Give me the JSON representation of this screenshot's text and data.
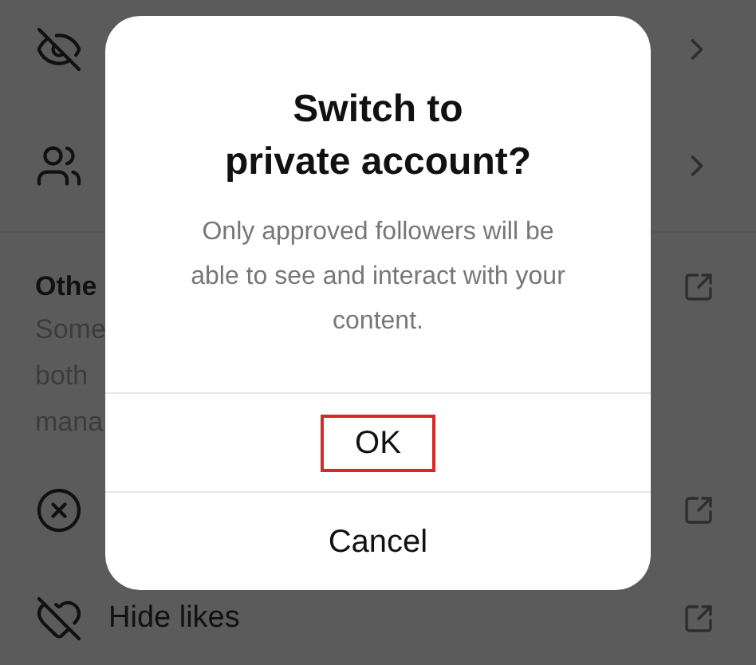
{
  "settings": [
    {
      "kind": "chevron"
    },
    {
      "kind": "chevron"
    }
  ],
  "other_section": {
    "title": "Othe",
    "description_lines": [
      "Some",
      "both",
      "mana"
    ],
    "kind": "external"
  },
  "actions": [
    {
      "kind": "external"
    },
    {
      "kind": "external",
      "label": "Hide likes"
    }
  ],
  "dialog": {
    "title": "Switch to\nprivate account?",
    "message": "Only approved followers will be able to see and interact with your content.",
    "buttons": [
      {
        "label": "OK",
        "highlighted": true
      },
      {
        "label": "Cancel",
        "highlighted": false
      }
    ]
  }
}
